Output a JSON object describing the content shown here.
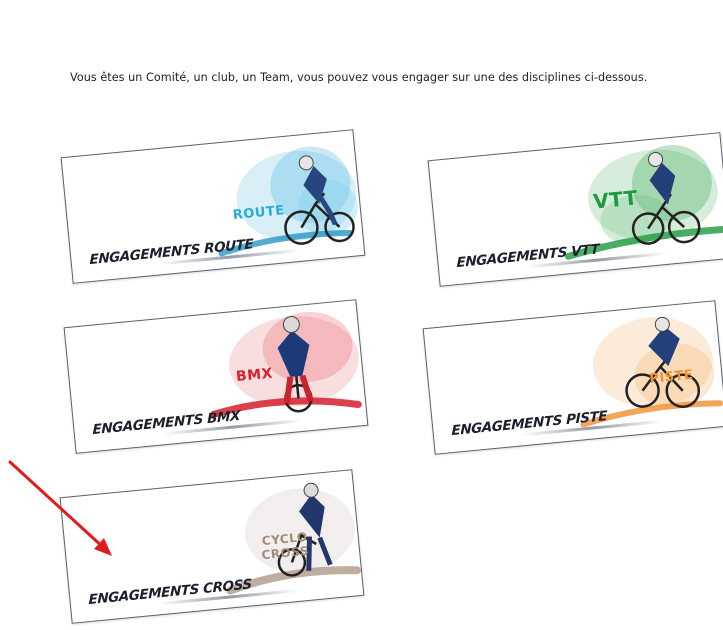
{
  "intro_text": "Vous êtes un Comité, un club, un Team, vous pouvez vous engager sur une des disciplines ci-dessous.",
  "cards": {
    "route": {
      "label": "ENGAGEMENTS ROUTE",
      "discipline": "ROUTE",
      "accent": "#2aa9d8"
    },
    "vtt": {
      "label": "ENGAGEMENTS VTT",
      "discipline": "VTT",
      "accent": "#1f9a3e"
    },
    "bmx": {
      "label": "ENGAGEMENTS BMX",
      "discipline": "BMX",
      "accent": "#d6202c"
    },
    "piste": {
      "label": "ENGAGEMENTS PISTE",
      "discipline": "PISTE",
      "accent": "#f0902e"
    },
    "cross": {
      "label": "ENGAGEMENTS CROSS",
      "discipline": "CYCLO CROSS",
      "accent": "#a48b77"
    }
  },
  "annotation": {
    "arrow_color": "#e01b1b"
  }
}
